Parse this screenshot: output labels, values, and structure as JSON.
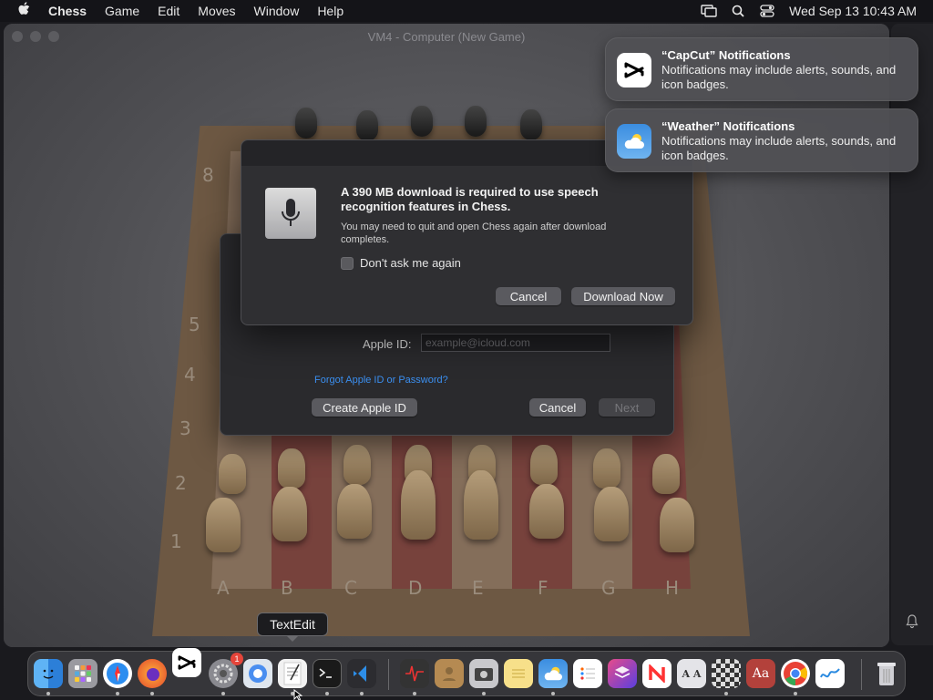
{
  "menubar": {
    "app_name": "Chess",
    "menus": [
      "Game",
      "Edit",
      "Moves",
      "Window",
      "Help"
    ],
    "clock": "Wed Sep 13  10:43 AM",
    "status_icons": [
      "screen-mirroring-icon",
      "spotlight-search-icon",
      "control-center-icon"
    ]
  },
  "window": {
    "title": "VM4 - Computer  (New Game)"
  },
  "board": {
    "ranks": [
      "8",
      "5",
      "4",
      "3",
      "2",
      "1"
    ],
    "files": [
      "A",
      "B",
      "C",
      "D",
      "E",
      "F",
      "G",
      "H"
    ]
  },
  "alert": {
    "title": "A 390 MB download is required to use speech recognition features in Chess.",
    "body": "You may need to quit and open Chess again after download completes.",
    "checkbox_label": "Don't ask me again",
    "checkbox_checked": false,
    "cancel_label": "Cancel",
    "download_label": "Download Now"
  },
  "apple_id_sheet": {
    "apple_id_label": "Apple ID:",
    "apple_id_placeholder": "example@icloud.com",
    "forgot_link": "Forgot Apple ID or Password?",
    "create_label": "Create Apple ID",
    "cancel_label": "Cancel",
    "next_label": "Next"
  },
  "notifications": [
    {
      "title": "“CapCut” Notifications",
      "body": "Notifications may include alerts, sounds, and icon badges.",
      "icon": "capcut-icon"
    },
    {
      "title": "“Weather” Notifications",
      "body": "Notifications may include alerts, sounds, and icon badges.",
      "icon": "weather-icon"
    }
  ],
  "tooltip": "TextEdit",
  "dock": {
    "settings_badge": "1",
    "dictionary_label": "Aa",
    "font_book_label": "A A"
  },
  "colors": {
    "accent_link": "#3b8ff0",
    "badge_red": "#e5453a"
  }
}
